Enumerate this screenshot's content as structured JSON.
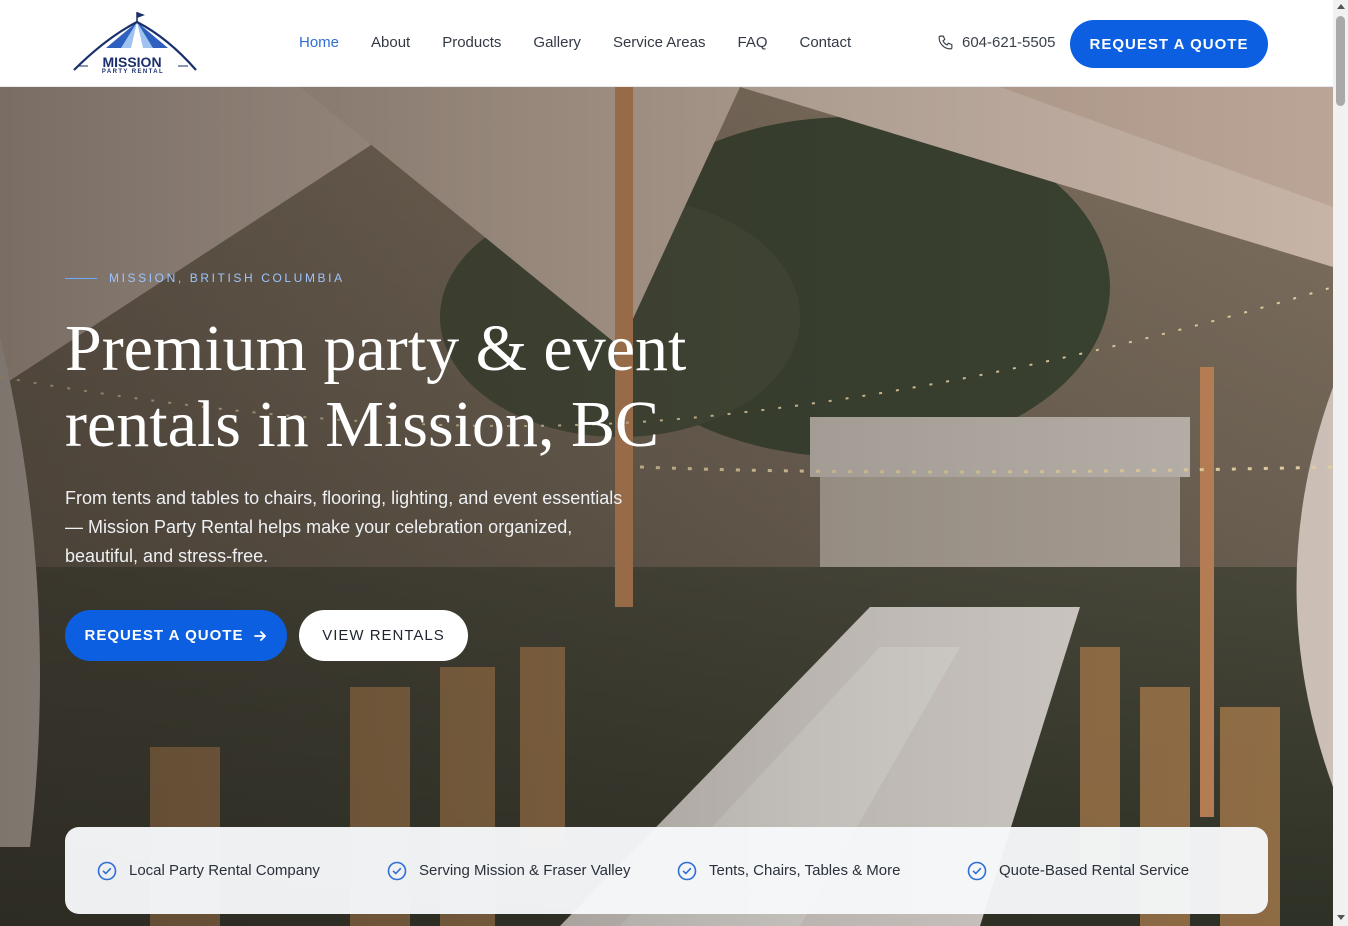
{
  "header": {
    "logo": {
      "name": "MISSION",
      "tagline": "PARTY RENTAL"
    },
    "nav": [
      {
        "label": "Home",
        "active": true
      },
      {
        "label": "About"
      },
      {
        "label": "Products"
      },
      {
        "label": "Gallery"
      },
      {
        "label": "Service Areas"
      },
      {
        "label": "FAQ"
      },
      {
        "label": "Contact"
      }
    ],
    "phone": "604-621-5505",
    "quote_button": "REQUEST A QUOTE"
  },
  "hero": {
    "eyebrow": "MISSION, BRITISH COLUMBIA",
    "title_line1": "Premium party & event",
    "title_line2": "rentals in Mission, BC",
    "subtitle": "From tents and tables to chairs, flooring, lighting, and event essentials — Mission Party Rental helps make your celebration organized, beautiful, and stress-free.",
    "primary_button": "REQUEST A QUOTE",
    "secondary_button": "VIEW RENTALS"
  },
  "features": [
    {
      "label": "Local Party Rental Company"
    },
    {
      "label": "Serving Mission & Fraser Valley"
    },
    {
      "label": "Tents, Chairs, Tables & More"
    },
    {
      "label": "Quote-Based Rental Service"
    }
  ],
  "colors": {
    "accent": "#0b5fe0",
    "nav_active": "#2f6fd6",
    "eyebrow": "#9cc4ff"
  },
  "icons": {
    "phone": "phone-icon",
    "arrow": "arrow-right-icon",
    "check": "check-circle-icon"
  }
}
